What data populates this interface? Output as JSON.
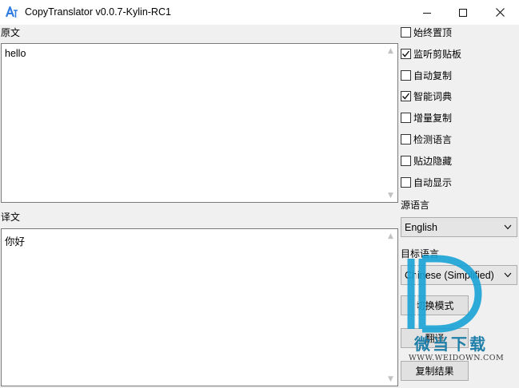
{
  "window": {
    "title": "CopyTranslator v0.0.7-Kylin-RC1",
    "icon": "translate-icon",
    "controls": [
      "minimize-icon",
      "maximize-icon",
      "close-icon"
    ]
  },
  "source": {
    "label": "原文",
    "text": "hello"
  },
  "result": {
    "label": "译文",
    "text": "你好"
  },
  "options": [
    {
      "label": "始终置顶",
      "checked": false
    },
    {
      "label": "监听剪贴板",
      "checked": true
    },
    {
      "label": "自动复制",
      "checked": false
    },
    {
      "label": "智能词典",
      "checked": true
    },
    {
      "label": "增量复制",
      "checked": false
    },
    {
      "label": "检测语言",
      "checked": false
    },
    {
      "label": "贴边隐藏",
      "checked": false
    },
    {
      "label": "自动显示",
      "checked": false
    }
  ],
  "source_language": {
    "label": "源语言",
    "selected": "English"
  },
  "target_language": {
    "label": "目标语言",
    "selected": "Chinese (Simplified)"
  },
  "buttons": {
    "switch_mode": "切换模式",
    "translate": "翻译",
    "copy_result": "复制结果"
  },
  "watermark": {
    "text": "微当下载",
    "url": "WWW.WEIDOWN.COM"
  }
}
